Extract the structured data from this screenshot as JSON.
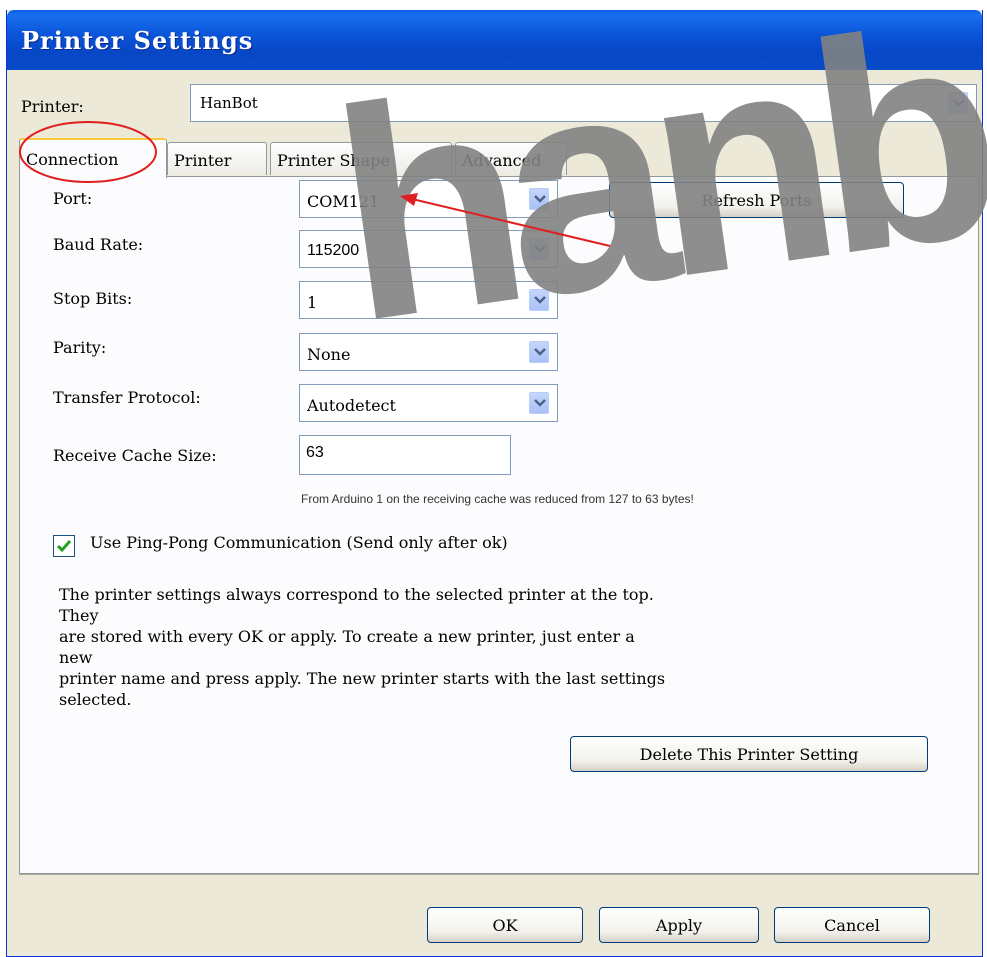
{
  "window": {
    "title": "Printer Settings"
  },
  "printer": {
    "label": "Printer:",
    "value": "HanBot"
  },
  "tabs": [
    {
      "label": "Connection"
    },
    {
      "label": "Printer"
    },
    {
      "label": "Printer Shape"
    },
    {
      "label": "Advanced"
    }
  ],
  "connection": {
    "port_label": "Port:",
    "port_value": "COM121",
    "refresh_button": "Refresh Ports",
    "baud_label": "Baud Rate:",
    "baud_value": "115200",
    "stop_label": "Stop Bits:",
    "stop_value": "1",
    "parity_label": "Parity:",
    "parity_value": "None",
    "protocol_label": "Transfer Protocol:",
    "protocol_value": "Autodetect",
    "cache_label": "Receive Cache Size:",
    "cache_value": "63",
    "cache_hint": "From Arduino 1 on the receiving cache was reduced from 127 to 63 bytes!",
    "pingpong_label": "Use Ping-Pong Communication (Send only after ok)",
    "pingpong_checked": true
  },
  "info_lines": [
    "The printer settings always correspond to the selected printer at the top.",
    "They",
    "are stored with every OK or apply. To create a new printer, just enter a",
    "new",
    "printer name and press apply. The new printer starts with the last settings",
    "selected."
  ],
  "delete_button": "Delete This Printer Setting",
  "footer": {
    "ok": "OK",
    "apply": "Apply",
    "cancel": "Cancel"
  },
  "watermark": "hanbot",
  "colors": {
    "title_bar": "#0b55d9",
    "annotation": "#e02020",
    "watermark": "#828282",
    "check": "#21a121"
  },
  "icons": [
    "chevron-down-icon",
    "checkmark-icon"
  ]
}
